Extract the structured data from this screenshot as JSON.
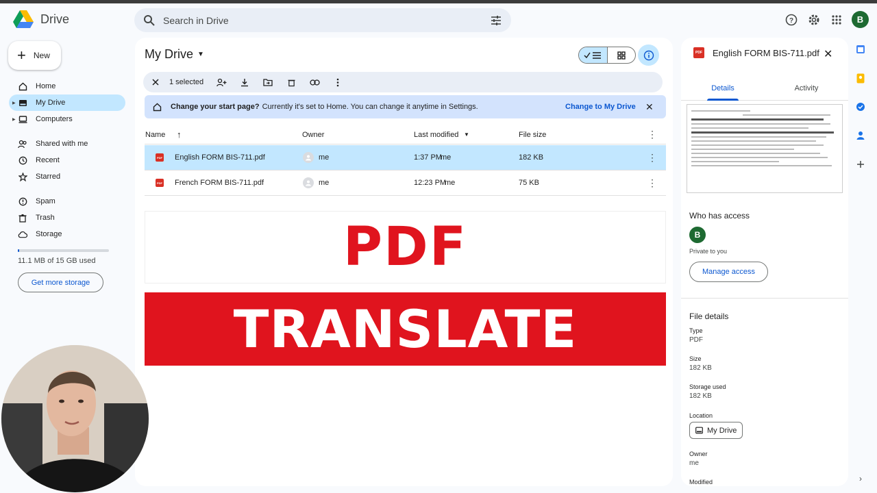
{
  "app": {
    "name": "Drive",
    "avatar_letter": "B"
  },
  "search": {
    "placeholder": "Search in Drive"
  },
  "header_icons": [
    "help-icon",
    "settings-icon",
    "apps-grid-icon"
  ],
  "sidebar": {
    "new_label": "New",
    "items": [
      {
        "label": "Home",
        "icon": "home-icon",
        "active": false
      },
      {
        "label": "My Drive",
        "icon": "my-drive-icon",
        "active": true
      },
      {
        "label": "Computers",
        "icon": "computer-icon",
        "active": false
      },
      {
        "label": "Shared with me",
        "icon": "shared-icon",
        "active": false
      },
      {
        "label": "Recent",
        "icon": "clock-icon",
        "active": false
      },
      {
        "label": "Starred",
        "icon": "star-icon",
        "active": false
      },
      {
        "label": "Spam",
        "icon": "spam-icon",
        "active": false
      },
      {
        "label": "Trash",
        "icon": "trash-icon",
        "active": false
      },
      {
        "label": "Storage",
        "icon": "cloud-icon",
        "active": false
      }
    ],
    "storage_used_text": "11.1 MB of 15 GB used",
    "storage_fraction": 0.0007,
    "get_storage_label": "Get more storage"
  },
  "main": {
    "title": "My Drive",
    "selection_text": "1 selected",
    "banner": {
      "strong": "Change your start page?",
      "text": "Currently it's set to Home. You can change it anytime in Settings.",
      "link": "Change to My Drive"
    },
    "columns": {
      "name": "Name",
      "owner": "Owner",
      "modified": "Last modified",
      "size": "File size"
    },
    "files": [
      {
        "name": "English FORM BIS-711.pdf",
        "owner": "me",
        "modified": "1:37 PM",
        "modified_by": "me",
        "size": "182 KB",
        "selected": true
      },
      {
        "name": "French FORM BIS-711.pdf",
        "owner": "me",
        "modified": "12:23 PM",
        "modified_by": "me",
        "size": "75 KB",
        "selected": false
      }
    ],
    "promo_line1": "PDF",
    "promo_line2": "TRANSLATE"
  },
  "details_panel": {
    "file_name": "English FORM BIS-711.pdf",
    "tabs": [
      "Details",
      "Activity"
    ],
    "active_tab": "Details",
    "who_has_access": "Who has access",
    "access_avatar": "B",
    "private_text": "Private to you",
    "manage_access": "Manage access",
    "file_details_heading": "File details",
    "details": [
      {
        "label": "Type",
        "value": "PDF"
      },
      {
        "label": "Size",
        "value": "182 KB"
      },
      {
        "label": "Storage used",
        "value": "182 KB"
      },
      {
        "label": "Location",
        "value": "My Drive"
      },
      {
        "label": "Owner",
        "value": "me"
      },
      {
        "label": "Modified",
        "value": ""
      }
    ]
  },
  "colors": {
    "accent": "#0b57d0",
    "selected_bg": "#c2e7ff",
    "promo_red": "#e0141e"
  }
}
